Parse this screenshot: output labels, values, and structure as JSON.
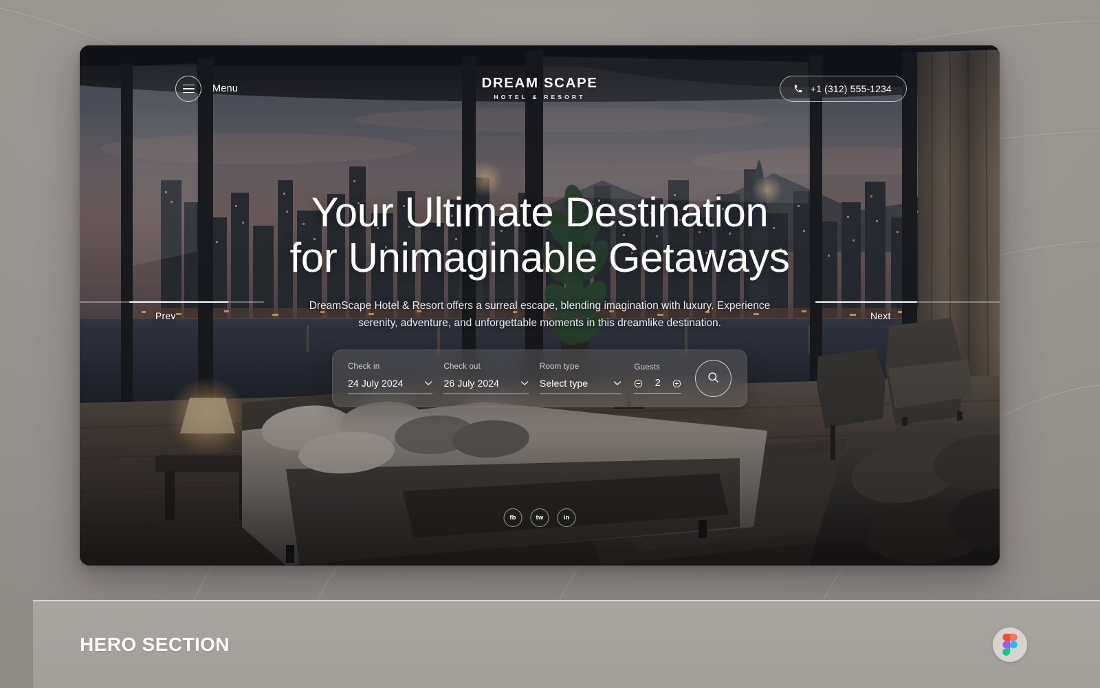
{
  "page": {
    "background_color": "#9a9590"
  },
  "hero": {
    "header": {
      "menu_label": "Menu",
      "menu_icon": "hamburger-icon",
      "brand_name": "DREAM SCAPE",
      "brand_subtitle": "HOTEL & RESORT",
      "phone_icon": "phone-icon",
      "phone_number": "+1 (312) 555-1234"
    },
    "headline_line1": "Your Ultimate Destination",
    "headline_line2": "for Unimaginable Getaways",
    "subheadline": "DreamScape Hotel & Resort offers a surreal escape, blending imagination with luxury. Experience serenity, adventure, and unforgettable moments in this dreamlike destination.",
    "slider": {
      "prev_label": "Prev",
      "next_label": "Next"
    },
    "booking": {
      "checkin": {
        "label": "Check in",
        "value": "24 July 2024",
        "icon": "chevron-down-icon"
      },
      "checkout": {
        "label": "Check out",
        "value": "26 July 2024",
        "icon": "chevron-down-icon"
      },
      "roomtype": {
        "label": "Room type",
        "value": "Select type",
        "icon": "chevron-down-icon"
      },
      "guests": {
        "label": "Guests",
        "value": "2",
        "decrement_icon": "minus-circle-icon",
        "increment_icon": "plus-circle-icon"
      },
      "search_icon": "search-icon"
    },
    "socials": [
      {
        "label": "fb",
        "name": "facebook"
      },
      {
        "label": "tw",
        "name": "twitter"
      },
      {
        "label": "in",
        "name": "linkedin"
      }
    ]
  },
  "footer": {
    "title": "HERO SECTION",
    "badge_icon": "figma-logo-icon",
    "badge_colors": {
      "red": "#f24e1e",
      "purple": "#a259ff",
      "blue": "#1abcfe",
      "green": "#0acf83"
    }
  }
}
